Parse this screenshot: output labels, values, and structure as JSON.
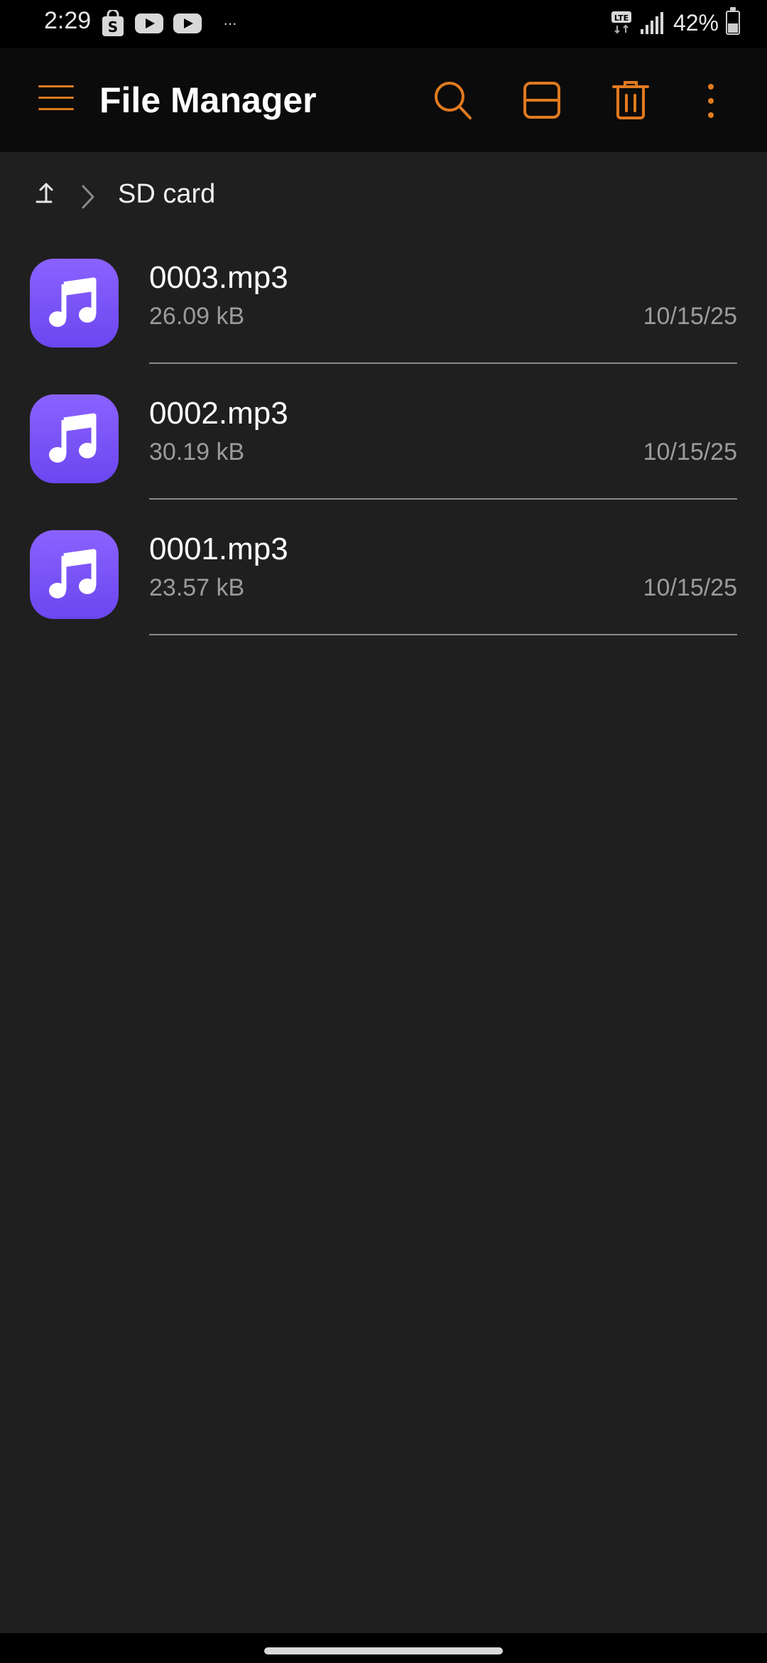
{
  "status_bar": {
    "time": "2:29",
    "more_indicator": "···",
    "network_label": "LTE",
    "battery_percent": "42%",
    "battery_level": 0.42
  },
  "app_bar": {
    "title": "File Manager",
    "accent_color": "#e07a1f"
  },
  "breadcrumb": {
    "current": "SD card"
  },
  "files": [
    {
      "name": "0003.mp3",
      "size": "26.09 kB",
      "date": "10/15/25"
    },
    {
      "name": "0002.mp3",
      "size": "30.19 kB",
      "date": "10/15/25"
    },
    {
      "name": "0001.mp3",
      "size": "23.57 kB",
      "date": "10/15/25"
    }
  ],
  "icons": {
    "menu": "hamburger-menu-icon",
    "search": "search-icon",
    "view": "view-toggle-icon",
    "delete": "trash-icon",
    "overflow": "more-vertical-icon",
    "up": "up-arrow-icon",
    "file_type": "music-note-icon"
  }
}
